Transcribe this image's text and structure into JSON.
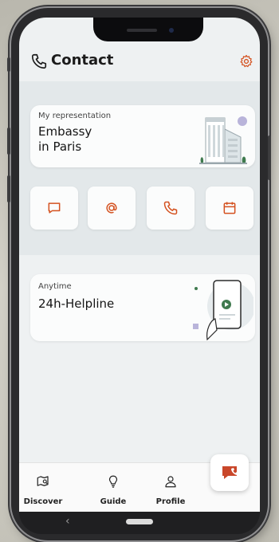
{
  "header": {
    "title": "Contact",
    "title_icon": "phone-icon",
    "settings_icon": "gear-icon"
  },
  "representation_card": {
    "caption": "My representation",
    "line1": "Embassy",
    "line2": "in Paris",
    "illustration": "embassy-building-illustration"
  },
  "quick_actions": [
    {
      "name": "message-icon"
    },
    {
      "name": "email-icon"
    },
    {
      "name": "phone-icon"
    },
    {
      "name": "calendar-icon"
    }
  ],
  "helpline_card": {
    "caption": "Anytime",
    "title": "24h-Helpline",
    "illustration": "phone-in-hand-illustration"
  },
  "bottom_nav": [
    {
      "label": "Discover",
      "icon": "map-search-icon"
    },
    {
      "label": "Guide",
      "icon": "lightbulb-icon"
    },
    {
      "label": "Profile",
      "icon": "person-icon"
    }
  ],
  "fab": {
    "icon": "chat-phone-icon"
  },
  "system_nav": {
    "back": "‹"
  },
  "colors": {
    "accent": "#d4511f",
    "fab_accent": "#c9472a",
    "band": "#e3e8ea",
    "screen_bg": "#eef1f2"
  }
}
